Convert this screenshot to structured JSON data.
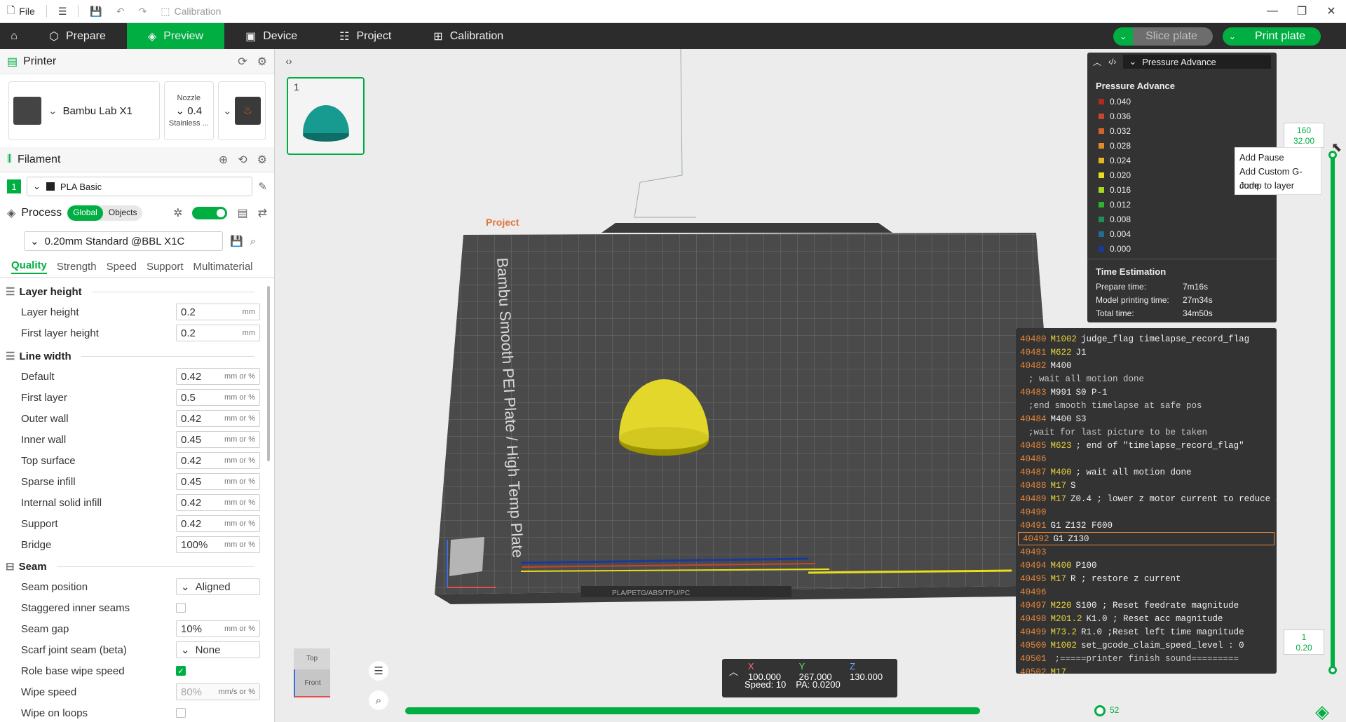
{
  "titlebar": {
    "file_label": "File",
    "calibration_label": "Calibration"
  },
  "tabs": {
    "prepare": "Prepare",
    "preview": "Preview",
    "device": "Device",
    "project": "Project",
    "calibration": "Calibration"
  },
  "actions": {
    "slice": "Slice plate",
    "print": "Print plate"
  },
  "printer": {
    "section_title": "Printer",
    "name": "Bambu Lab X1",
    "nozzle_label": "Nozzle",
    "nozzle_value": "0.4",
    "nozzle_type": "Stainless ..."
  },
  "filament": {
    "section_title": "Filament",
    "slot": "1",
    "name": "PLA Basic"
  },
  "process": {
    "section_title": "Process",
    "toggle_global": "Global",
    "toggle_objects": "Objects",
    "preset": "0.20mm Standard @BBL X1C",
    "subtabs": [
      "Quality",
      "Strength",
      "Speed",
      "Support",
      "Multimaterial"
    ]
  },
  "quality": {
    "layer_height_group": "Layer height",
    "layer_height": {
      "label": "Layer height",
      "value": "0.2",
      "unit": "mm"
    },
    "first_layer_height": {
      "label": "First layer height",
      "value": "0.2",
      "unit": "mm"
    },
    "line_width_group": "Line width",
    "line_widths": [
      {
        "label": "Default",
        "value": "0.42",
        "unit": "mm or %"
      },
      {
        "label": "First layer",
        "value": "0.5",
        "unit": "mm or %"
      },
      {
        "label": "Outer wall",
        "value": "0.42",
        "unit": "mm or %"
      },
      {
        "label": "Inner wall",
        "value": "0.45",
        "unit": "mm or %"
      },
      {
        "label": "Top surface",
        "value": "0.42",
        "unit": "mm or %"
      },
      {
        "label": "Sparse infill",
        "value": "0.45",
        "unit": "mm or %"
      },
      {
        "label": "Internal solid infill",
        "value": "0.42",
        "unit": "mm or %"
      },
      {
        "label": "Support",
        "value": "0.42",
        "unit": "mm or %"
      },
      {
        "label": "Bridge",
        "value": "100%",
        "unit": "mm or %"
      }
    ],
    "seam_group": "Seam",
    "seam_position": {
      "label": "Seam position",
      "value": "Aligned"
    },
    "staggered_inner_seams": {
      "label": "Staggered inner seams"
    },
    "seam_gap": {
      "label": "Seam gap",
      "value": "10%",
      "unit": "mm or %"
    },
    "scarf_joint": {
      "label": "Scarf joint seam (beta)",
      "value": "None"
    },
    "role_base_wipe": {
      "label": "Role base wipe speed"
    },
    "wipe_speed": {
      "label": "Wipe speed",
      "value": "80%",
      "unit": "mm/s or %"
    },
    "wipe_on_loops": {
      "label": "Wipe on loops"
    }
  },
  "plate": {
    "thumb_number": "1",
    "project_label": "Project",
    "plate_text": "Bambu Smooth PEI Plate / High Temp Plate",
    "plate_bottom_text": "PLA/PETG/ABS/TPU/PC"
  },
  "legend": {
    "combo": "Pressure Advance",
    "title": "Pressure Advance",
    "items": [
      {
        "value": "0.040",
        "color": "#b02a1e"
      },
      {
        "value": "0.036",
        "color": "#c8472a"
      },
      {
        "value": "0.032",
        "color": "#d5622a"
      },
      {
        "value": "0.028",
        "color": "#e08a27"
      },
      {
        "value": "0.024",
        "color": "#e8b420"
      },
      {
        "value": "0.020",
        "color": "#e9de1a"
      },
      {
        "value": "0.016",
        "color": "#a6d81f"
      },
      {
        "value": "0.012",
        "color": "#2fb22f"
      },
      {
        "value": "0.008",
        "color": "#1f8f5a"
      },
      {
        "value": "0.004",
        "color": "#1f6e8f"
      },
      {
        "value": "0.000",
        "color": "#1a3a9a"
      }
    ],
    "time_title": "Time Estimation",
    "prepare_label": "Prepare time:",
    "prepare_value": "7m16s",
    "model_label": "Model printing time:",
    "model_value": "27m34s",
    "total_label": "Total time:",
    "total_value": "34m50s"
  },
  "gcode_lines": [
    {
      "n": "40480",
      "cmd": "M1002",
      "rest": "judge_flag timelapse_record_flag",
      "style": "y"
    },
    {
      "n": "40481",
      "cmd": "M622",
      "rest": "J1",
      "style": "y"
    },
    {
      "n": "40482",
      "cmd": "M400",
      "rest": "",
      "style": "w"
    },
    {
      "n": "",
      "cmd": "",
      "rest": "; wait all motion done",
      "style": "c"
    },
    {
      "n": "40483",
      "cmd": "M991",
      "rest": "S0 P-1",
      "style": "w"
    },
    {
      "n": "",
      "cmd": "",
      "rest": ";end smooth timelapse at safe pos",
      "style": "c"
    },
    {
      "n": "40484",
      "cmd": "M400",
      "rest": "S3",
      "style": "w"
    },
    {
      "n": "",
      "cmd": "",
      "rest": ";wait for last picture to be taken",
      "style": "c"
    },
    {
      "n": "40485",
      "cmd": "M623",
      "rest": "; end of \"timelapse_record_flag\"",
      "style": "y"
    },
    {
      "n": "40486",
      "cmd": "",
      "rest": "",
      "style": "w"
    },
    {
      "n": "40487",
      "cmd": "M400",
      "rest": "; wait all motion done",
      "style": "y"
    },
    {
      "n": "40488",
      "cmd": "M17",
      "rest": "S",
      "style": "y"
    },
    {
      "n": "40489",
      "cmd": "M17",
      "rest": "Z0.4 ; lower z motor current to reduce impact if...",
      "style": "y"
    },
    {
      "n": "40490",
      "cmd": "",
      "rest": "",
      "style": "w"
    },
    {
      "n": "40491",
      "cmd": "G1",
      "rest": "Z132 F600",
      "style": "w"
    },
    {
      "n": "40492",
      "cmd": "G1",
      "rest": "Z130",
      "style": "w",
      "current": true
    },
    {
      "n": "40493",
      "cmd": "",
      "rest": "",
      "style": "w"
    },
    {
      "n": "40494",
      "cmd": "M400",
      "rest": "P100",
      "style": "y"
    },
    {
      "n": "40495",
      "cmd": "M17",
      "rest": "R ; restore z current",
      "style": "y"
    },
    {
      "n": "40496",
      "cmd": "",
      "rest": "",
      "style": "w"
    },
    {
      "n": "40497",
      "cmd": "M220",
      "rest": "S100 ; Reset feedrate magnitude",
      "style": "y"
    },
    {
      "n": "40498",
      "cmd": "M201.2",
      "rest": "K1.0 ; Reset acc magnitude",
      "style": "y"
    },
    {
      "n": "40499",
      "cmd": "M73.2",
      "rest": "R1.0 ;Reset left time magnitude",
      "style": "y"
    },
    {
      "n": "40500",
      "cmd": "M1002",
      "rest": "set_gcode_claim_speed_level : 0",
      "style": "y"
    },
    {
      "n": "40501",
      "cmd": "",
      "rest": ";=====printer finish  sound=========",
      "style": "c"
    },
    {
      "n": "40502",
      "cmd": "M17",
      "rest": "",
      "style": "y"
    }
  ],
  "layer_slider": {
    "top_layer": "160",
    "top_height": "32.00",
    "bottom_layer": "1",
    "bottom_height": "0.20"
  },
  "context_menu": [
    "Add Pause",
    "Add Custom G-code",
    "Jump to layer"
  ],
  "move_slider": {
    "value": "52"
  },
  "coords": {
    "x_label": "X",
    "x": "100.000",
    "y_label": "Y",
    "y": "267.000",
    "z_label": "Z",
    "z": "130.000",
    "speed_label": "Speed:",
    "speed": "10",
    "pa_label": "PA:",
    "pa": "0.0200"
  },
  "viewcube": {
    "top": "Top",
    "front": "Front"
  }
}
